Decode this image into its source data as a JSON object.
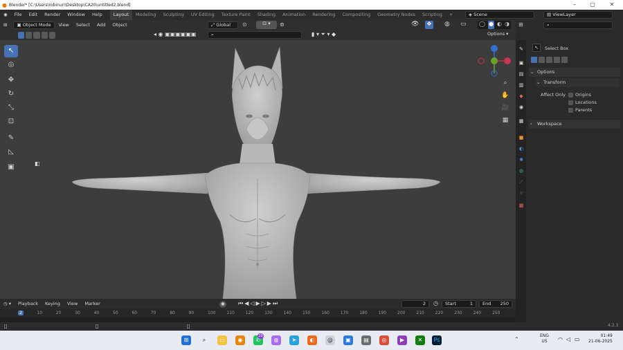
{
  "window": {
    "title": "Blender* [C:\\Users\\robinuri\\Desktop\\CA20\\untitled2.blend]",
    "min": "–",
    "max": "▢",
    "close": "✕"
  },
  "top_menu": [
    "File",
    "Edit",
    "Render",
    "Window",
    "Help"
  ],
  "workspace_tabs": [
    "Layout",
    "Modeling",
    "Sculpting",
    "UV Editing",
    "Texture Paint",
    "Shading",
    "Animation",
    "Rendering",
    "Compositing",
    "Geometry Nodes",
    "Scripting"
  ],
  "add_workspace": "+",
  "scene": "Scene",
  "view_layer": "ViewLayer",
  "viewport_header": {
    "mode": "Object Mode",
    "menus": [
      "View",
      "Select",
      "Add",
      "Object"
    ],
    "transform_orientation": "Global",
    "options": "Options"
  },
  "toolbar": {
    "tools": [
      "select-box",
      "cursor",
      "move",
      "rotate",
      "scale",
      "transform",
      "annotate",
      "measure",
      "add-cube"
    ]
  },
  "properties": {
    "tool_name": "Select Box",
    "options_label": "Options",
    "transform_label": "Transform",
    "affect_only_label": "Affect Only",
    "affect_only_items": [
      "Origins",
      "Locations",
      "Parents"
    ],
    "workspace_label": "Workspace"
  },
  "timeline": {
    "menus": [
      "Playback",
      "Keying",
      "View",
      "Marker"
    ],
    "current_frame": "2",
    "start_label": "Start",
    "start_value": "1",
    "end_label": "End",
    "end_value": "250",
    "ruler": [
      "2",
      "10",
      "20",
      "30",
      "40",
      "50",
      "60",
      "70",
      "80",
      "90",
      "100",
      "110",
      "120",
      "130",
      "140",
      "150",
      "160",
      "170",
      "180",
      "190",
      "200",
      "210",
      "220",
      "230",
      "240",
      "250"
    ]
  },
  "status": {
    "version": "4.2.3"
  },
  "taskbar": {
    "lang": "ENG",
    "region": "US",
    "time": "01:49",
    "date": "21-06-2025",
    "badge_whatsapp": "20"
  },
  "colors": {
    "accent": "#4772b3",
    "viewport": "#3d3d3d",
    "mesh": "#bdbdbd"
  }
}
